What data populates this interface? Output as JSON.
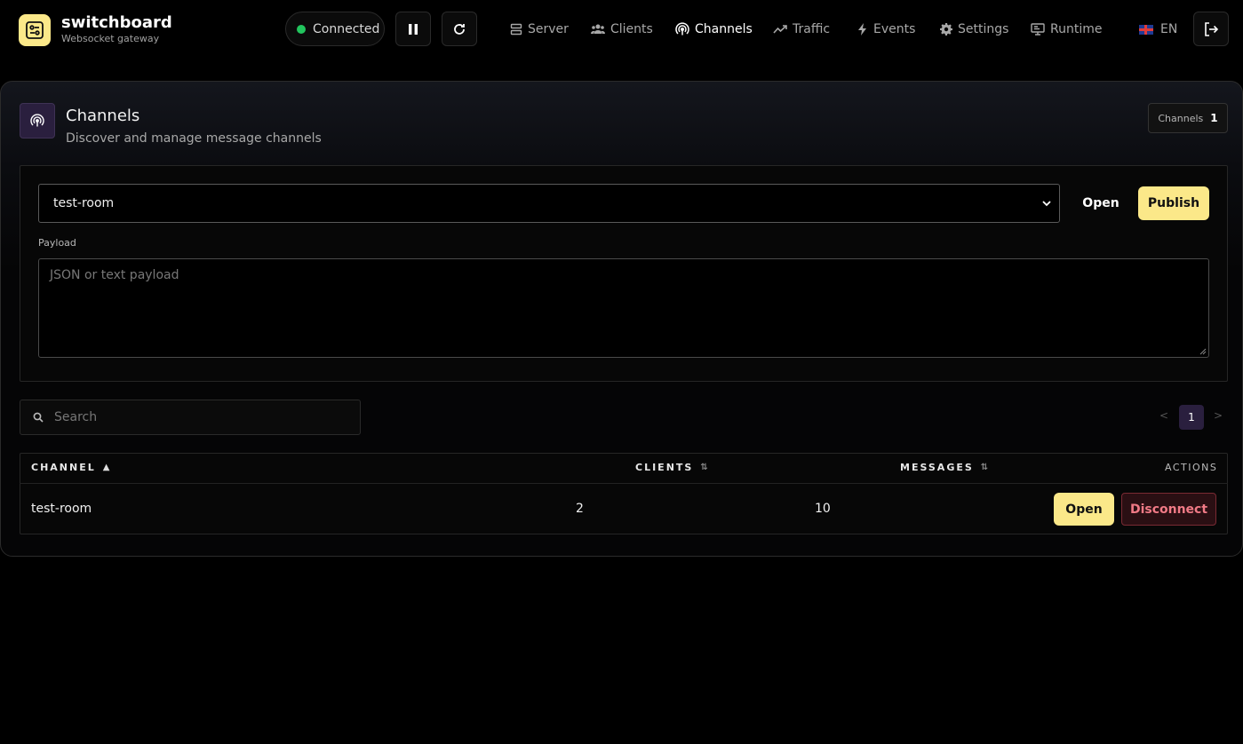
{
  "app": {
    "title": "switchboard",
    "subtitle": "Websocket gateway"
  },
  "status": {
    "label": "Connected",
    "color": "#22c55e"
  },
  "toolbar": {
    "pause_icon": "pause-icon",
    "refresh_icon": "refresh-icon"
  },
  "nav": [
    {
      "label": "Server",
      "icon": "server-icon"
    },
    {
      "label": "Clients",
      "icon": "users-icon"
    },
    {
      "label": "Channels",
      "icon": "broadcast-icon",
      "active": true
    },
    {
      "label": "Traffic",
      "icon": "trend-icon"
    },
    {
      "label": "Events",
      "icon": "bolt-icon"
    },
    {
      "label": "Settings",
      "icon": "gear-icon"
    },
    {
      "label": "Runtime",
      "icon": "monitor-icon"
    }
  ],
  "language": {
    "label": "EN",
    "flag": "uk-flag-icon"
  },
  "logout_icon": "logout-icon",
  "page": {
    "title": "Channels",
    "subtitle": "Discover and manage message channels",
    "count_label": "Channels",
    "count_value": "1"
  },
  "publish": {
    "selected_channel": "test-room",
    "open_label": "Open",
    "publish_label": "Publish",
    "payload_label": "Payload",
    "payload_placeholder": "JSON or text payload"
  },
  "search": {
    "placeholder": "Search"
  },
  "pagination": {
    "prev": "<",
    "current": "1",
    "next": ">"
  },
  "table": {
    "columns": {
      "channel": "CHANNEL",
      "clients": "CLIENTS",
      "messages": "MESSAGES",
      "actions": "ACTIONS"
    },
    "sort_asc": "▲",
    "sort_neutral": "⇅",
    "rows": [
      {
        "channel": "test-room",
        "clients": "2",
        "messages": "10",
        "open_label": "Open",
        "disconnect_label": "Disconnect"
      }
    ]
  },
  "colors": {
    "accent": "#fbe889",
    "background": "#000000",
    "danger": "#f07a86"
  }
}
